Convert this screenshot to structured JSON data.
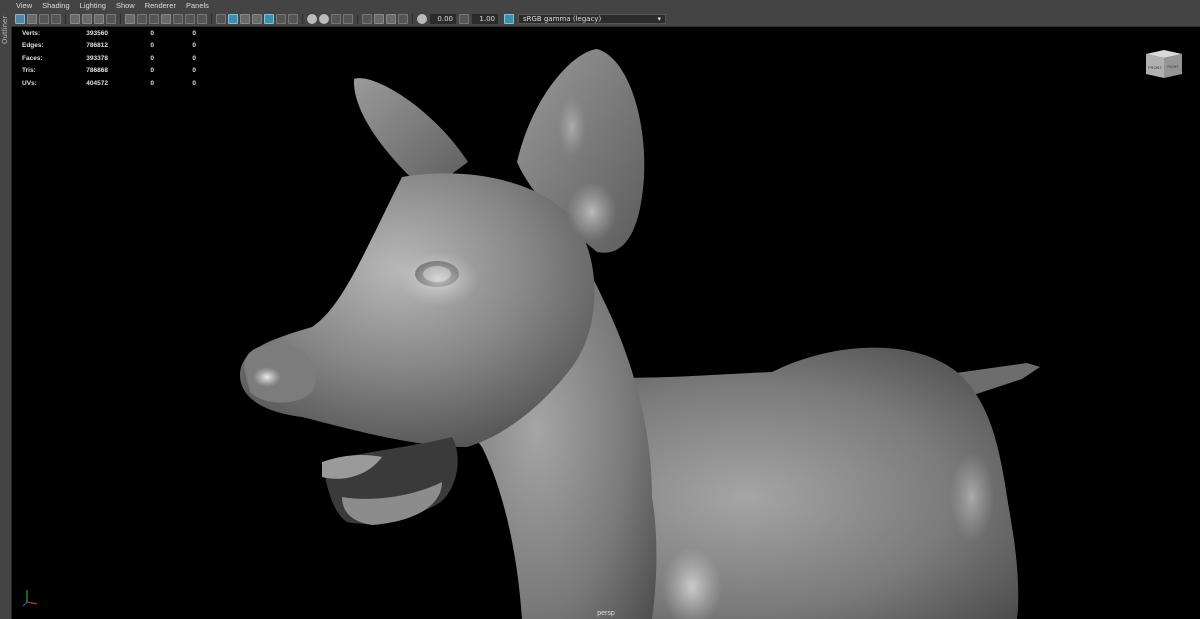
{
  "outliner": {
    "label": "Outliner"
  },
  "menu": [
    "View",
    "Shading",
    "Lighting",
    "Show",
    "Renderer",
    "Panels"
  ],
  "toolbar": {
    "exposure": "0.00",
    "gamma": "1.00",
    "color_space": "sRGB gamma (legacy)"
  },
  "hud": {
    "rows": [
      {
        "label": "Verts:",
        "v1": "393560",
        "v2": "0",
        "v3": "0"
      },
      {
        "label": "Edges:",
        "v1": "786812",
        "v2": "0",
        "v3": "0"
      },
      {
        "label": "Faces:",
        "v1": "393378",
        "v2": "0",
        "v3": "0"
      },
      {
        "label": "Tris:",
        "v1": "786868",
        "v2": "0",
        "v3": "0"
      },
      {
        "label": "UVs:",
        "v1": "404572",
        "v2": "0",
        "v3": "0"
      }
    ]
  },
  "viewcube": {
    "front": "FRONT",
    "right": "RIGHT"
  },
  "viewport": {
    "camera": "persp"
  },
  "colors": {
    "accent": "#5285a6",
    "panel": "#444444",
    "viewport_bg": "#000000",
    "model": "#8a8a8a"
  }
}
